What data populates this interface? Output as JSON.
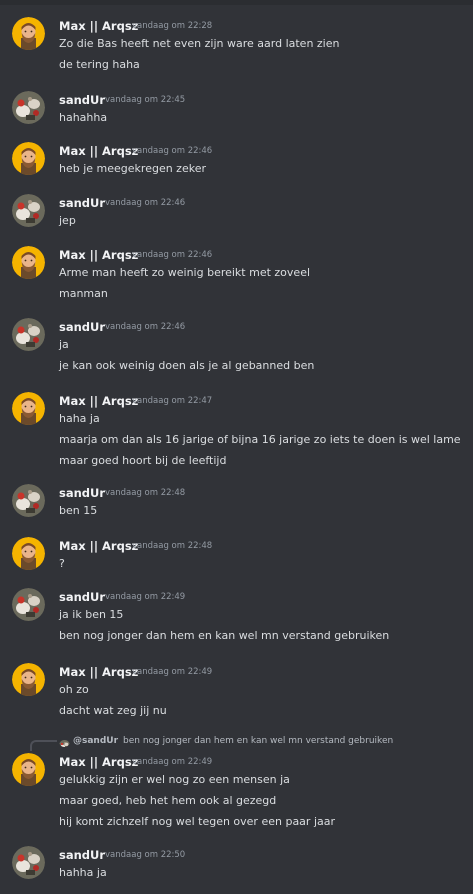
{
  "messages": [
    {
      "author": "Max || Arqsz",
      "timestamp": "vandaag om 22:28",
      "avatar": "bearded-man-avatar",
      "lines": [
        "Zo die Bas heeft net even zijn ware aard laten zien",
        "de tering haha"
      ]
    },
    {
      "author": "sandUr",
      "timestamp": "vandaag om 22:45",
      "avatar": "sandur-avatar",
      "lines": [
        "hahahha"
      ]
    },
    {
      "author": "Max || Arqsz",
      "timestamp": "vandaag om 22:46",
      "avatar": "bearded-man-avatar",
      "lines": [
        "heb je meegekregen zeker"
      ]
    },
    {
      "author": "sandUr",
      "timestamp": "vandaag om 22:46",
      "avatar": "sandur-avatar",
      "lines": [
        "jep"
      ]
    },
    {
      "author": "Max || Arqsz",
      "timestamp": "vandaag om 22:46",
      "avatar": "bearded-man-avatar",
      "lines": [
        "Arme man heeft zo weinig bereikt met zoveel",
        "manman"
      ]
    },
    {
      "author": "sandUr",
      "timestamp": "vandaag om 22:46",
      "avatar": "sandur-avatar",
      "lines": [
        "ja",
        "je kan ook weinig doen als je al gebanned ben"
      ]
    },
    {
      "author": "Max || Arqsz",
      "timestamp": "vandaag om 22:47",
      "avatar": "bearded-man-avatar",
      "lines": [
        "haha ja",
        "maarja om dan als 16 jarige of bijna 16 jarige zo iets te doen is wel lame",
        "maar goed hoort bij de leeftijd"
      ]
    },
    {
      "author": "sandUr",
      "timestamp": "vandaag om 22:48",
      "avatar": "sandur-avatar",
      "lines": [
        "ben 15"
      ]
    },
    {
      "author": "Max || Arqsz",
      "timestamp": "vandaag om 22:48",
      "avatar": "bearded-man-avatar",
      "lines": [
        "?"
      ]
    },
    {
      "author": "sandUr",
      "timestamp": "vandaag om 22:49",
      "avatar": "sandur-avatar",
      "lines": [
        "ja ik ben 15",
        "ben nog jonger dan hem en kan wel mn verstand gebruiken"
      ]
    },
    {
      "author": "Max || Arqsz",
      "timestamp": "vandaag om 22:49",
      "avatar": "bearded-man-avatar",
      "lines": [
        "oh zo",
        "dacht wat zeg jij nu"
      ]
    },
    {
      "author": "Max || Arqsz",
      "timestamp": "vandaag om 22:49",
      "avatar": "bearded-man-avatar",
      "reply": {
        "user": "@sandUr",
        "text": "ben nog jonger dan hem en kan wel mn verstand gebruiken"
      },
      "lines": [
        "gelukkig zijn er wel nog zo een mensen ja",
        "maar goed, heb het hem ook al gezegd",
        "hij komt zichzelf nog wel tegen over een paar jaar"
      ]
    },
    {
      "author": "sandUr",
      "timestamp": "vandaag om 22:50",
      "avatar": "sandur-avatar",
      "lines": [
        "hahha ja"
      ]
    }
  ],
  "colors": {
    "background": "#313338",
    "author": "#f2f3f5",
    "timestamp": "#949ba4",
    "text": "#dbdee1"
  }
}
